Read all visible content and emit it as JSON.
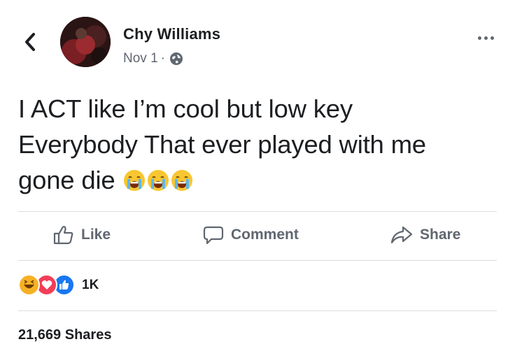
{
  "header": {
    "back_icon": "chevron-left-icon",
    "author_name": "Chy Williams",
    "date": "Nov 1",
    "separator": "·",
    "privacy_icon": "globe-icon",
    "more_icon": "more-options-icon"
  },
  "post": {
    "text_lines": [
      "I ACT like I’m cool but low key",
      "Everybody That ever played with me",
      "gone die"
    ],
    "emojis": [
      "loudly-crying-face-icon",
      "loudly-crying-face-icon",
      "loudly-crying-face-icon"
    ]
  },
  "actions": {
    "like_label": "Like",
    "comment_label": "Comment",
    "share_label": "Share"
  },
  "engagement": {
    "reaction_icons": [
      "haha-reaction-icon",
      "love-reaction-icon",
      "like-reaction-icon"
    ],
    "reaction_count": "1K",
    "shares_text": "21,669 Shares"
  },
  "colors": {
    "text_primary": "#1c1e21",
    "text_secondary": "#606770",
    "like_blue": "#1877f2",
    "love_red": "#f33e58",
    "haha_yellow": "#f7b125",
    "divider": "#dadde1"
  }
}
